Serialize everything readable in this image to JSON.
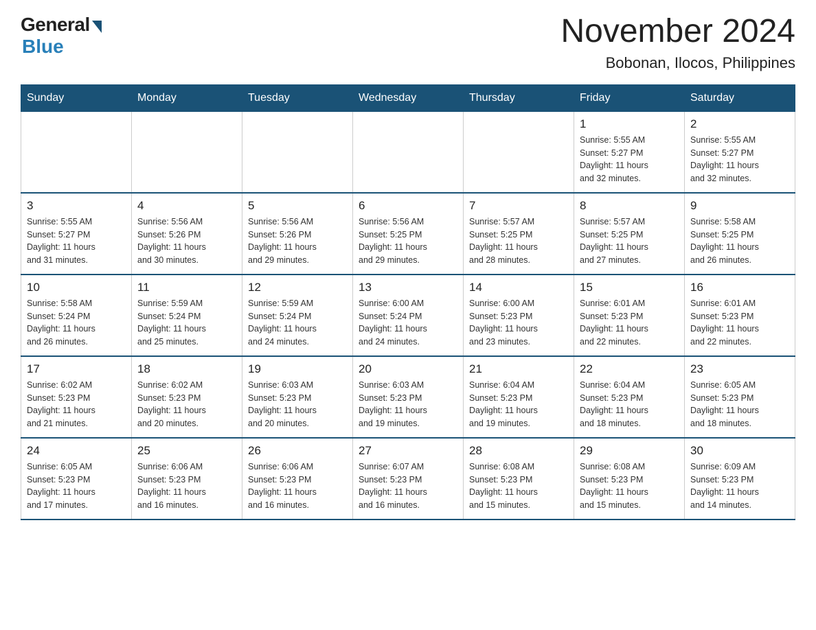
{
  "header": {
    "logo_general": "General",
    "logo_blue": "Blue",
    "month_title": "November 2024",
    "subtitle": "Bobonan, Ilocos, Philippines"
  },
  "weekdays": [
    "Sunday",
    "Monday",
    "Tuesday",
    "Wednesday",
    "Thursday",
    "Friday",
    "Saturday"
  ],
  "weeks": [
    [
      {
        "day": "",
        "info": ""
      },
      {
        "day": "",
        "info": ""
      },
      {
        "day": "",
        "info": ""
      },
      {
        "day": "",
        "info": ""
      },
      {
        "day": "",
        "info": ""
      },
      {
        "day": "1",
        "info": "Sunrise: 5:55 AM\nSunset: 5:27 PM\nDaylight: 11 hours\nand 32 minutes."
      },
      {
        "day": "2",
        "info": "Sunrise: 5:55 AM\nSunset: 5:27 PM\nDaylight: 11 hours\nand 32 minutes."
      }
    ],
    [
      {
        "day": "3",
        "info": "Sunrise: 5:55 AM\nSunset: 5:27 PM\nDaylight: 11 hours\nand 31 minutes."
      },
      {
        "day": "4",
        "info": "Sunrise: 5:56 AM\nSunset: 5:26 PM\nDaylight: 11 hours\nand 30 minutes."
      },
      {
        "day": "5",
        "info": "Sunrise: 5:56 AM\nSunset: 5:26 PM\nDaylight: 11 hours\nand 29 minutes."
      },
      {
        "day": "6",
        "info": "Sunrise: 5:56 AM\nSunset: 5:25 PM\nDaylight: 11 hours\nand 29 minutes."
      },
      {
        "day": "7",
        "info": "Sunrise: 5:57 AM\nSunset: 5:25 PM\nDaylight: 11 hours\nand 28 minutes."
      },
      {
        "day": "8",
        "info": "Sunrise: 5:57 AM\nSunset: 5:25 PM\nDaylight: 11 hours\nand 27 minutes."
      },
      {
        "day": "9",
        "info": "Sunrise: 5:58 AM\nSunset: 5:25 PM\nDaylight: 11 hours\nand 26 minutes."
      }
    ],
    [
      {
        "day": "10",
        "info": "Sunrise: 5:58 AM\nSunset: 5:24 PM\nDaylight: 11 hours\nand 26 minutes."
      },
      {
        "day": "11",
        "info": "Sunrise: 5:59 AM\nSunset: 5:24 PM\nDaylight: 11 hours\nand 25 minutes."
      },
      {
        "day": "12",
        "info": "Sunrise: 5:59 AM\nSunset: 5:24 PM\nDaylight: 11 hours\nand 24 minutes."
      },
      {
        "day": "13",
        "info": "Sunrise: 6:00 AM\nSunset: 5:24 PM\nDaylight: 11 hours\nand 24 minutes."
      },
      {
        "day": "14",
        "info": "Sunrise: 6:00 AM\nSunset: 5:23 PM\nDaylight: 11 hours\nand 23 minutes."
      },
      {
        "day": "15",
        "info": "Sunrise: 6:01 AM\nSunset: 5:23 PM\nDaylight: 11 hours\nand 22 minutes."
      },
      {
        "day": "16",
        "info": "Sunrise: 6:01 AM\nSunset: 5:23 PM\nDaylight: 11 hours\nand 22 minutes."
      }
    ],
    [
      {
        "day": "17",
        "info": "Sunrise: 6:02 AM\nSunset: 5:23 PM\nDaylight: 11 hours\nand 21 minutes."
      },
      {
        "day": "18",
        "info": "Sunrise: 6:02 AM\nSunset: 5:23 PM\nDaylight: 11 hours\nand 20 minutes."
      },
      {
        "day": "19",
        "info": "Sunrise: 6:03 AM\nSunset: 5:23 PM\nDaylight: 11 hours\nand 20 minutes."
      },
      {
        "day": "20",
        "info": "Sunrise: 6:03 AM\nSunset: 5:23 PM\nDaylight: 11 hours\nand 19 minutes."
      },
      {
        "day": "21",
        "info": "Sunrise: 6:04 AM\nSunset: 5:23 PM\nDaylight: 11 hours\nand 19 minutes."
      },
      {
        "day": "22",
        "info": "Sunrise: 6:04 AM\nSunset: 5:23 PM\nDaylight: 11 hours\nand 18 minutes."
      },
      {
        "day": "23",
        "info": "Sunrise: 6:05 AM\nSunset: 5:23 PM\nDaylight: 11 hours\nand 18 minutes."
      }
    ],
    [
      {
        "day": "24",
        "info": "Sunrise: 6:05 AM\nSunset: 5:23 PM\nDaylight: 11 hours\nand 17 minutes."
      },
      {
        "day": "25",
        "info": "Sunrise: 6:06 AM\nSunset: 5:23 PM\nDaylight: 11 hours\nand 16 minutes."
      },
      {
        "day": "26",
        "info": "Sunrise: 6:06 AM\nSunset: 5:23 PM\nDaylight: 11 hours\nand 16 minutes."
      },
      {
        "day": "27",
        "info": "Sunrise: 6:07 AM\nSunset: 5:23 PM\nDaylight: 11 hours\nand 16 minutes."
      },
      {
        "day": "28",
        "info": "Sunrise: 6:08 AM\nSunset: 5:23 PM\nDaylight: 11 hours\nand 15 minutes."
      },
      {
        "day": "29",
        "info": "Sunrise: 6:08 AM\nSunset: 5:23 PM\nDaylight: 11 hours\nand 15 minutes."
      },
      {
        "day": "30",
        "info": "Sunrise: 6:09 AM\nSunset: 5:23 PM\nDaylight: 11 hours\nand 14 minutes."
      }
    ]
  ]
}
